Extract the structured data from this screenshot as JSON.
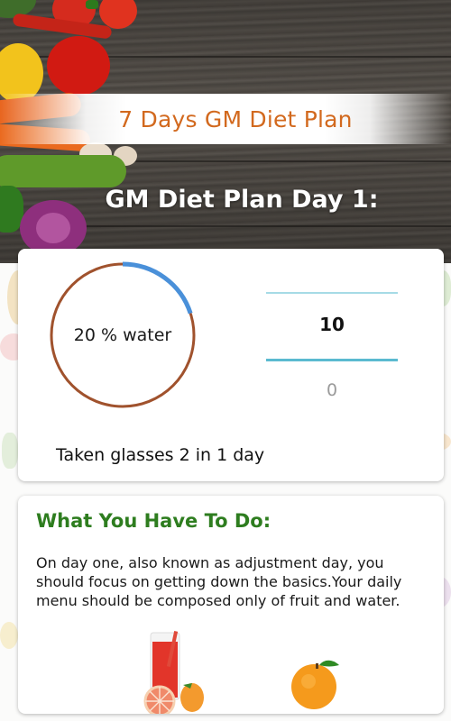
{
  "header": {
    "app_title": "7 Days GM Diet Plan",
    "day_title": "GM Diet Plan Day 1:"
  },
  "water_tracker": {
    "progress_label": "20 % water",
    "progress_fraction": 0.2,
    "picker_current": "10",
    "picker_next": "0",
    "taken_text": "Taken glasses 2 in 1 day",
    "colors": {
      "ring": "#a0522d",
      "progress": "#4a90d9",
      "picker_line": "#5bbad0"
    }
  },
  "instructions": {
    "title": "What You Have To Do:",
    "body": "On day one, also known as adjustment day, you should focus on getting down the basics.Your daily menu should be composed only of fruit and water.",
    "colors": {
      "title": "#2e7d1f"
    }
  },
  "icons": [
    "vegetables-image",
    "juice-glass-icon",
    "grapefruit-icon",
    "orange-icon"
  ]
}
